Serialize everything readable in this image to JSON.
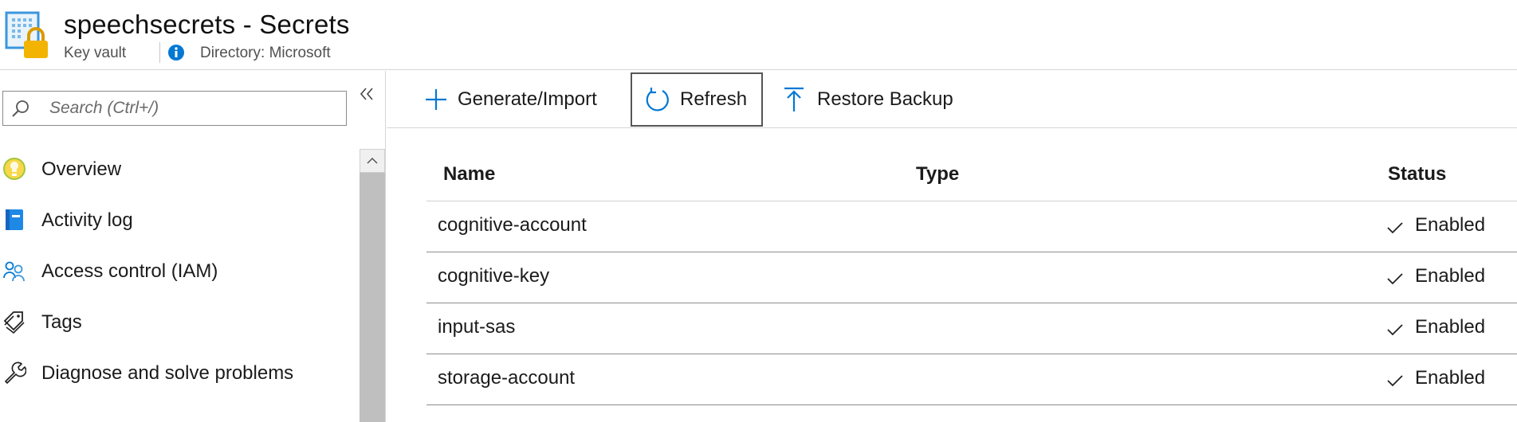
{
  "header": {
    "title": "speechsecrets - Secrets",
    "resource_type": "Key vault",
    "directory": "Directory: Microsoft",
    "logo_icon": "key-vault-icon",
    "info_icon": "info-icon"
  },
  "sidebar": {
    "search": {
      "placeholder": "Search (Ctrl+/)",
      "value": ""
    },
    "collapse_icon": "double-chevron-left-icon",
    "items": [
      {
        "label": "Overview",
        "icon": "overview-icon"
      },
      {
        "label": "Activity log",
        "icon": "activity-log-icon"
      },
      {
        "label": "Access control (IAM)",
        "icon": "people-icon"
      },
      {
        "label": "Tags",
        "icon": "tag-icon"
      },
      {
        "label": "Diagnose and solve problems",
        "icon": "wrench-icon"
      }
    ]
  },
  "toolbar": {
    "generate_label": "Generate/Import",
    "refresh_label": "Refresh",
    "restore_label": "Restore Backup"
  },
  "table": {
    "columns": [
      "Name",
      "Type",
      "Status"
    ],
    "rows": [
      {
        "name": "cognitive-account",
        "type": "",
        "status": "Enabled"
      },
      {
        "name": "cognitive-key",
        "type": "",
        "status": "Enabled"
      },
      {
        "name": "input-sas",
        "type": "",
        "status": "Enabled"
      },
      {
        "name": "storage-account",
        "type": "",
        "status": "Enabled"
      }
    ]
  },
  "colors": {
    "accent": "#0078d4",
    "lock": "#f2b400",
    "border": "#d6d6d6"
  }
}
